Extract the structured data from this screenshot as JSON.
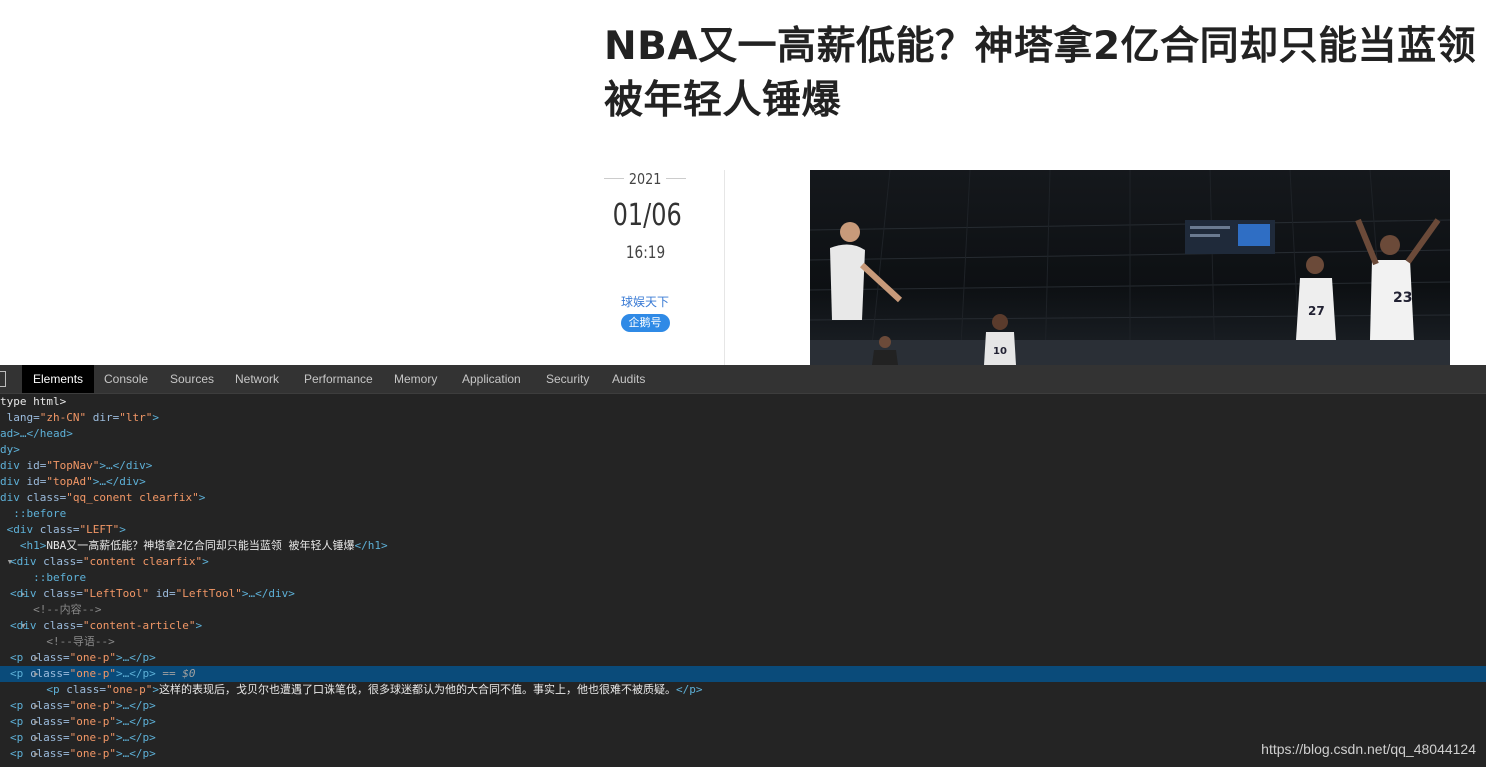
{
  "article": {
    "title_line1": "NBA又一高薪低能？神塔拿2亿合同却只能当蓝领",
    "title_line2": "被年轻人锤爆",
    "date_year": "2021",
    "date_md": "01/06",
    "time": "16:19",
    "source": "球娱天下",
    "badge": "企鹅号"
  },
  "devtools": {
    "tabs": [
      "Elements",
      "Console",
      "Sources",
      "Network",
      "Performance",
      "Memory",
      "Application",
      "Security",
      "Audits"
    ],
    "active_tab": "Elements",
    "dom": {
      "doctype": "type html>",
      "html_attrs_prefix": " lang=",
      "html_lang": "\"zh-CN\"",
      "html_dir_attr": " dir=",
      "html_dir": "\"ltr\"",
      "head": "ad>…</head>",
      "body": "dy>",
      "topnav_id": "\"TopNav\"",
      "topad_id": "\"topAd\"",
      "qq_class": "\"qq_conent clearfix\"",
      "before": "::before",
      "left_class": "\"LEFT\"",
      "h1_text": "NBA又一高薪低能？神塔拿2亿合同却只能当蓝领 被年轻人锤爆",
      "content_class": "\"content clearfix\"",
      "lefttool_class": "\"LeftTool\"",
      "lefttool_id": "\"LeftTool\"",
      "comment_content": "<!--内容-->",
      "article_class": "\"content-article\"",
      "comment_lead": "<!--导语-->",
      "p_class": "\"one-p\"",
      "selected_marker": " == $0",
      "p_text": "这样的表现后，戈贝尔也遭遇了口诛笔伐，很多球迷都认为他的大合同不值。事实上，他也很难不被质疑。"
    },
    "watermark": "https://blog.csdn.net/qq_48044124"
  }
}
